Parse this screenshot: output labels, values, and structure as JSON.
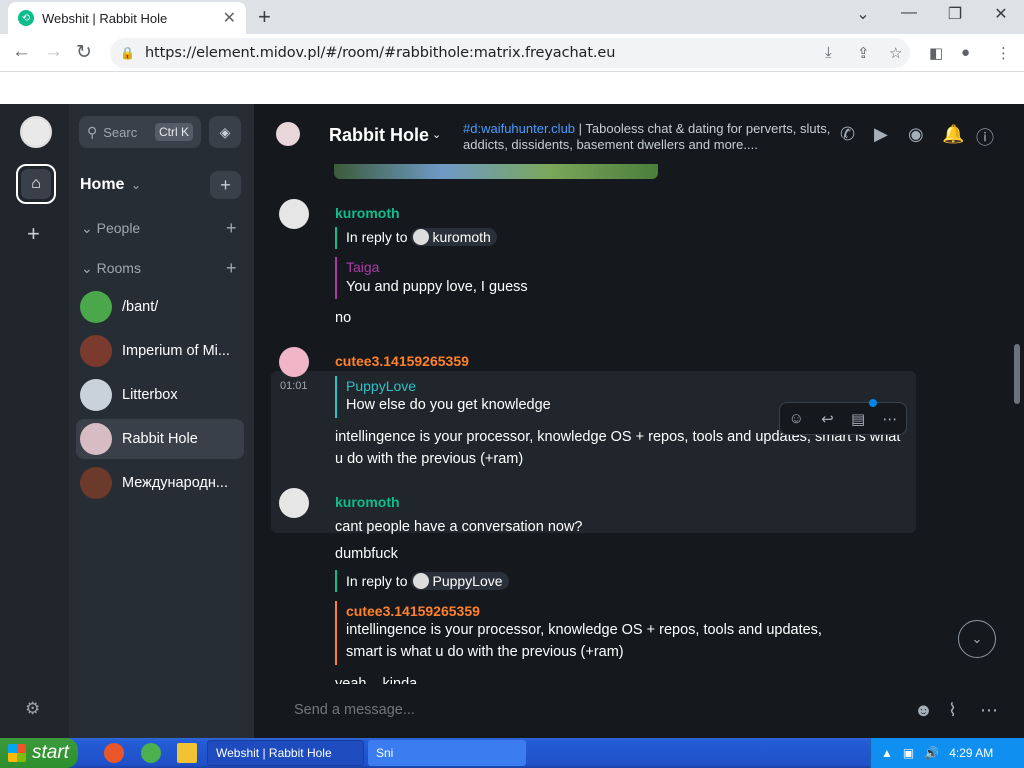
{
  "browser": {
    "tab_title": "Webshit | Rabbit Hole",
    "url": "https://element.midov.pl/#/room/#rabbithole:matrix.freyachat.eu"
  },
  "sidebar": {
    "search_placeholder": "Searc",
    "search_shortcut": "Ctrl K",
    "home_label": "Home",
    "people_label": "People",
    "rooms_label": "Rooms",
    "rooms": [
      {
        "name": "/bant/",
        "color": "#4aa84a"
      },
      {
        "name": "Imperium of Mi...",
        "color": "#7a3b2e"
      },
      {
        "name": "Litterbox",
        "color": "#c9d2da"
      },
      {
        "name": "Rabbit Hole",
        "color": "#d8bcc3"
      },
      {
        "name": "Международн...",
        "color": "#6b3a2a"
      }
    ]
  },
  "room": {
    "name": "Rabbit Hole",
    "topic_link": "#d:waifuhunter.club",
    "topic_sep": " | ",
    "topic_text": "Tabooless chat & dating for perverts, sluts, addicts, dissidents, basement dwellers and more...."
  },
  "messages": {
    "m1": {
      "sender": "kuromoth",
      "reply_label": "In reply to",
      "reply_user": "kuromoth",
      "quote_sender": "Taiga",
      "quote_body": "You and puppy love, I guess",
      "body": "no"
    },
    "m2": {
      "sender": "cutee3.14159265359",
      "timestamp": "01:01",
      "quote_sender": "PuppyLove",
      "quote_body": "How else do you get knowledge",
      "body": "intellingence is your processor, knowledge OS + repos, tools and updates, smart is what u do with the previous (+ram)"
    },
    "m3": {
      "sender": "kuromoth",
      "body1": "cant people have a conversation now?",
      "body2": "dumbfuck",
      "reply_label": "In reply to",
      "reply_user": "PuppyLove",
      "quote_sender": "cutee3.14159265359",
      "quote_body_1": "intellingence is your processor, knowledge OS + repos, tools and updates,",
      "quote_body_2": "smart is what u do with the previous (+ram)",
      "cut_text": "yeah... kinda"
    }
  },
  "composer": {
    "placeholder": "Send a message..."
  },
  "taskbar": {
    "start_label": "start",
    "task1": "Webshit | Rabbit Hole",
    "task2": "Sni",
    "clock": "4:29 AM"
  },
  "colors": {
    "accent": "#0dbd8b",
    "sender_green": "#0dbd8b",
    "sender_orange": "#ff812d",
    "taiga_purple": "#ac3ba8",
    "puppylove_teal": "#2dc2c5"
  }
}
